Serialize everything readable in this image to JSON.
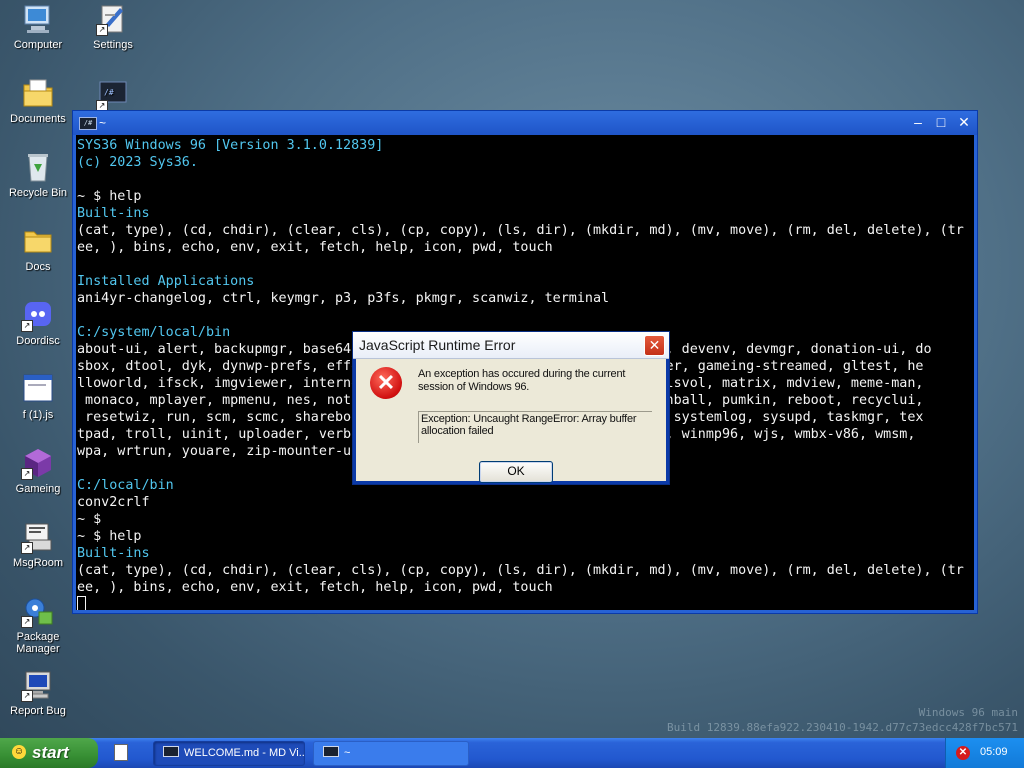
{
  "desktop_icons": [
    {
      "label": "Computer"
    },
    {
      "label": "Settings"
    },
    {
      "label": "Documents"
    },
    {
      "label": "Recycle Bin"
    },
    {
      "label": "Docs"
    },
    {
      "label": "Doordisc"
    },
    {
      "label": "f (1).js"
    },
    {
      "label": "Gameing"
    },
    {
      "label": "MsgRoom"
    },
    {
      "label": "Package Manager"
    },
    {
      "label": "Report Bug"
    }
  ],
  "terminal": {
    "title": "~",
    "lines": [
      "SYS36 Windows 96 [Version 3.1.0.12839]",
      "(c) 2023 Sys36.",
      "",
      "~ $ help",
      "Built-ins",
      "(cat, type), (cd, chdir), (clear, cls), (cp, copy), (ls, dir), (mkdir, md), (mv, move), (rm, del, delete), (tr",
      "ee, ), bins, echo, env, exit, fetch, help, icon, pwd, touch",
      "",
      "Installed Applications",
      "ani4yr-changelog, ctrl, keymgr, p3, p3fs, pkmgr, scanwiz, terminal",
      "",
      "C:/system/local/bin",
      "about-ui, alert, backupmgr, base64                                    its, devenv, devmgr, donation-ui, do",
      "sbox, dtool, dyk, dynwp-prefs, effe                                  runner, gameing-streamed, gltest, he",
      "lloworld, ifsck, imgviewer, interne                                  on, lsvol, matrix, mdview, meme-man,",
      " monaco, mplayer, mpmenu, nes, notr                                  , pinball, pumkin, reboot, recyclui,",
      " resetwiz, run, scm, scmc, shareboa                                  erm, systemlog, sysupd, taskmgr, tex",
      "tpad, troll, uinit, uploader, verbi                                  chat, winmp96, wjs, wmbx-v86, wmsm,",
      "wpa, wrtrun, youare, zip-mounter-ui",
      "",
      "C:/local/bin",
      "conv2crlf",
      "~ $",
      "~ $ help",
      "Built-ins",
      "(cat, type), (cd, chdir), (clear, cls), (cp, copy), (ls, dir), (mkdir, md), (mv, move), (rm, del, delete), (tr",
      "ee, ), bins, echo, env, exit, fetch, help, icon, pwd, touch"
    ],
    "cyan_lines": [
      0,
      1,
      4,
      8,
      11,
      20,
      24
    ]
  },
  "dialog": {
    "title": "JavaScript Runtime Error",
    "message": "An exception has occured during the current session of Windows 96.",
    "detail": "Exception: Uncaught RangeError: Array buffer allocation failed",
    "ok_label": "OK"
  },
  "watermark": {
    "line1": "Windows 96 main",
    "line2": "Build 12839.88efa922.230410-1942.d77c73edcc428f7bc571"
  },
  "taskbar": {
    "start_label": "start",
    "tasks": [
      {
        "label": "WELCOME.md - MD Vi..."
      },
      {
        "label": "~"
      }
    ],
    "clock": "05:09"
  }
}
